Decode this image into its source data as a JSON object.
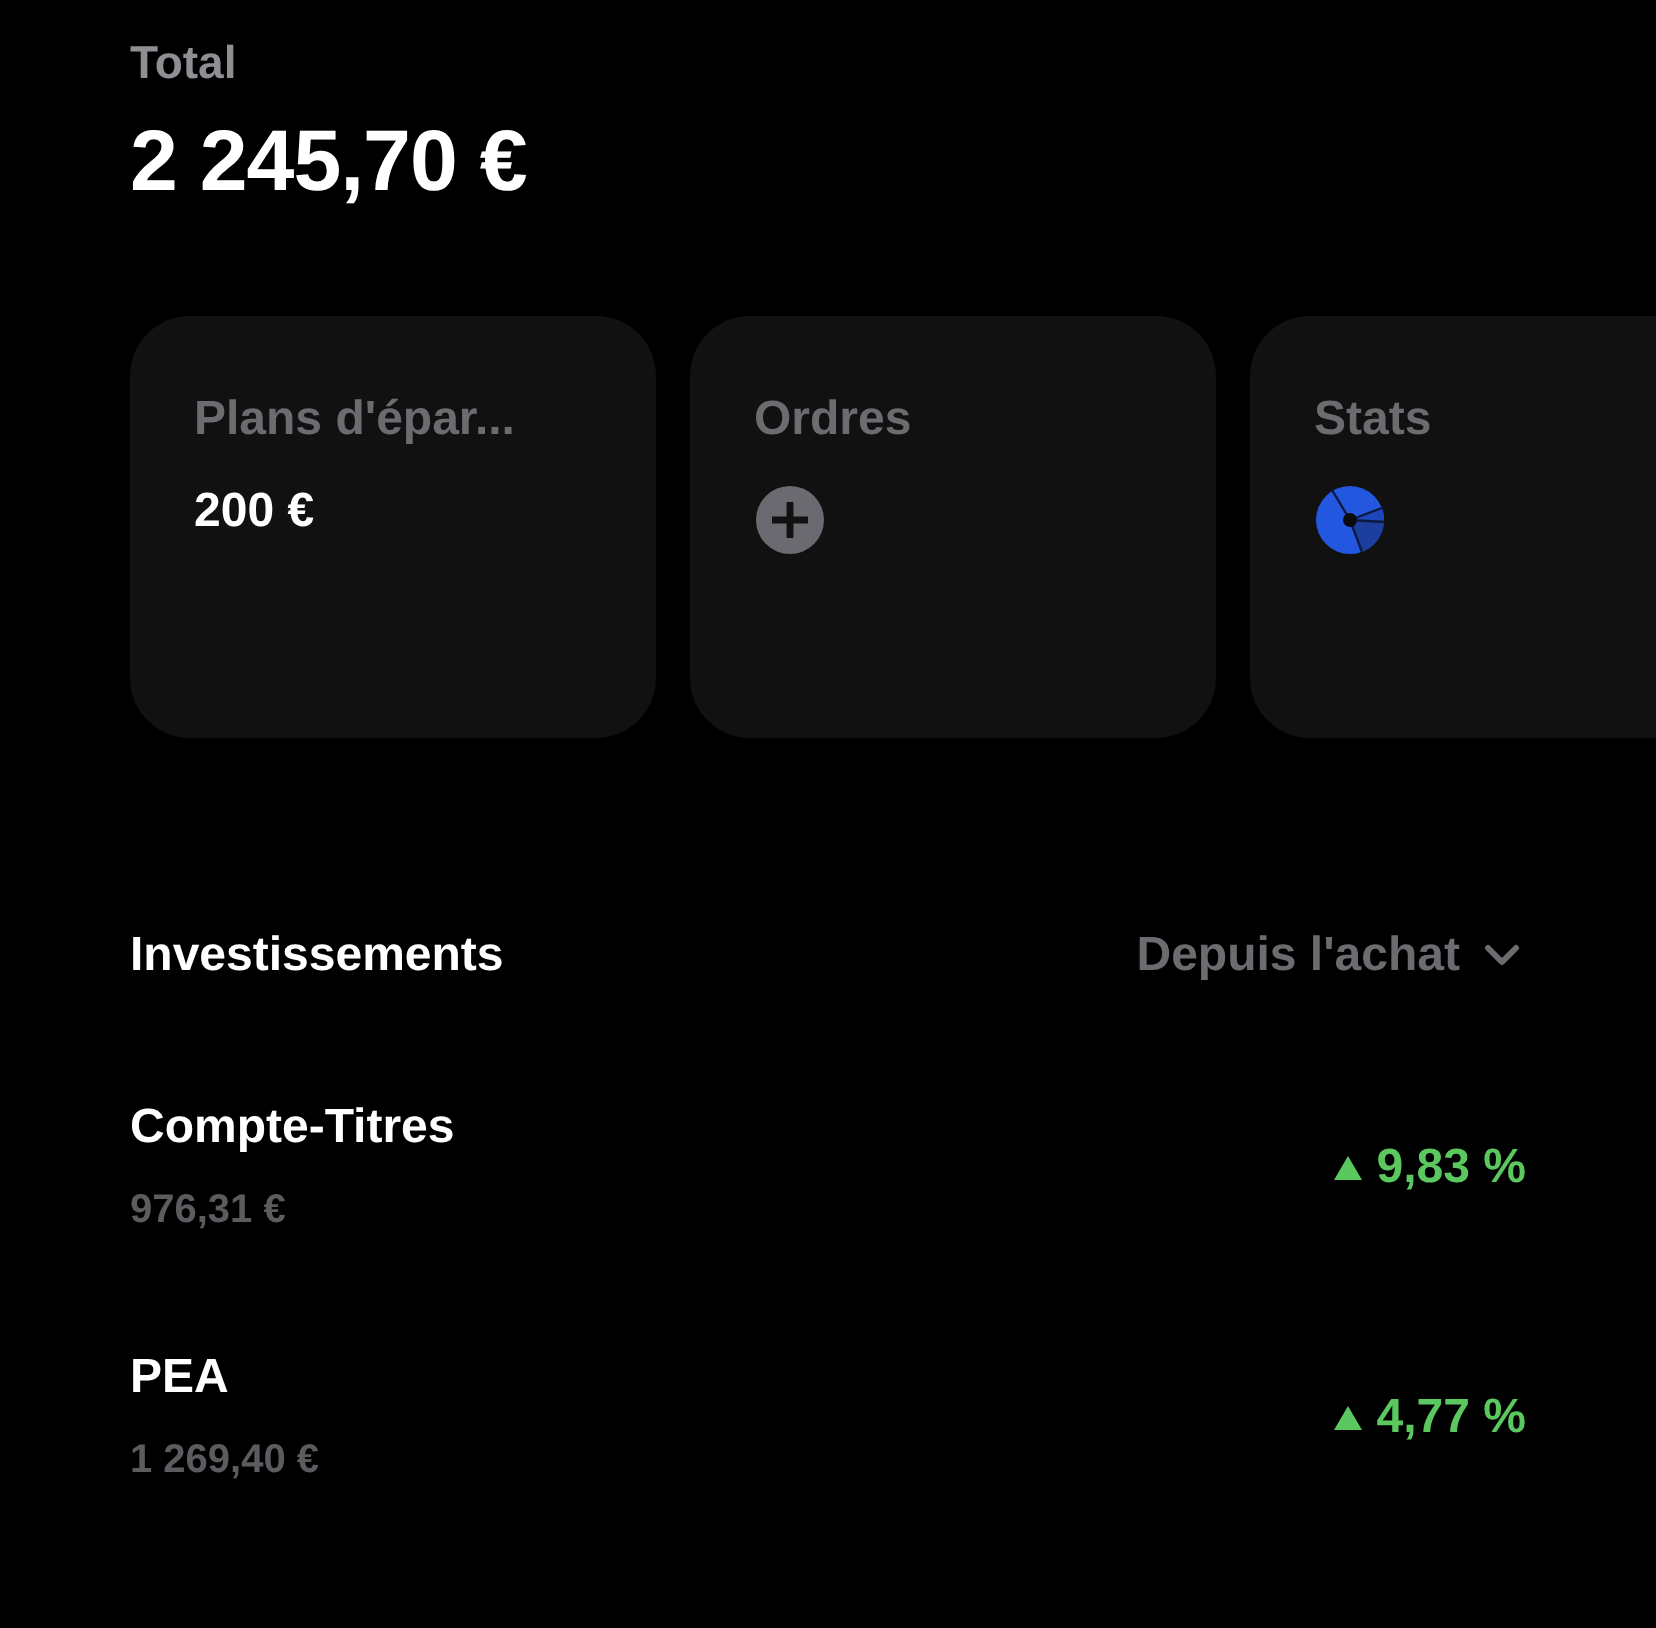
{
  "total": {
    "label": "Total",
    "amount": "2 245,70 €"
  },
  "cards": [
    {
      "kind": "value",
      "title": "Plans d'épar...",
      "value": "200 €"
    },
    {
      "kind": "add",
      "title": "Ordres"
    },
    {
      "kind": "chart",
      "title": "Stats"
    }
  ],
  "investments": {
    "title": "Investissements",
    "period": "Depuis l'achat",
    "rows": [
      {
        "name": "Compte-Titres",
        "value": "976,31 €",
        "rising": true,
        "change": "9,83 %"
      },
      {
        "name": "PEA",
        "value": "1 269,40 €",
        "rising": true,
        "change": "4,77 %"
      }
    ]
  }
}
